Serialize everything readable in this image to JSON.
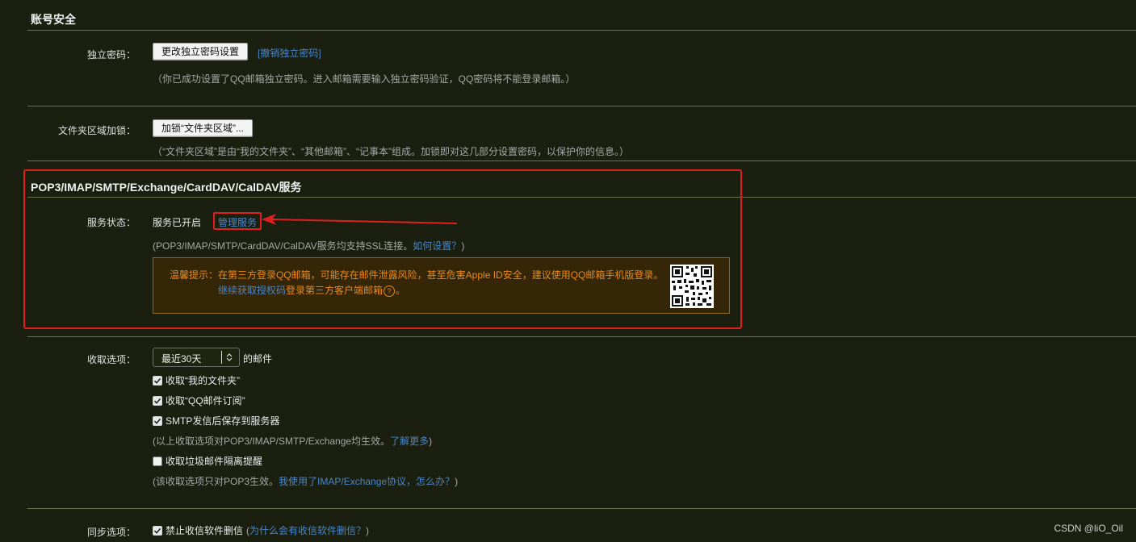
{
  "account_security": {
    "title": "账号安全",
    "independent_password": {
      "label": "独立密码：",
      "change_button": "更改独立密码设置",
      "revoke_link": "[撤销独立密码]",
      "note": "（你已成功设置了QQ邮箱独立密码。进入邮箱需要输入独立密码验证，QQ密码将不能登录邮箱。）"
    },
    "folder_lock": {
      "label": "文件夹区域加锁：",
      "button": "加锁“文件夹区域”...",
      "note": "（“文件夹区域”是由“我的文件夹”、“其他邮箱”、“记事本”组成。加锁即对这几部分设置密码，以保护你的信息。）"
    }
  },
  "services": {
    "title": "POP3/IMAP/SMTP/Exchange/CardDAV/CalDAV服务",
    "status": {
      "label": "服务状态：",
      "value": "服务已开启",
      "manage_link": "管理服务",
      "note_prefix": "(POP3/IMAP/SMTP/CardDAV/CalDAV服务均支持SSL连接。",
      "note_link": "如何设置？",
      "note_suffix": ")"
    },
    "warning": {
      "heading": "温馨提示：",
      "text": "在第三方登录QQ邮箱，可能存在邮件泄露风险，甚至危害Apple ID安全，建议使用QQ邮箱手机版登录。",
      "link": "继续获取授权码",
      "text2": "登录第三方客户端邮箱",
      "help_icon": "?",
      "end": "。"
    },
    "highlight_color": "#e02020"
  },
  "receive_options": {
    "label": "收取选项：",
    "range_select": "最近30天",
    "range_suffix": "的邮件",
    "checks": [
      {
        "label": "收取“我的文件夹”",
        "checked": true
      },
      {
        "label": "收取“QQ邮件订阅”",
        "checked": true
      },
      {
        "label": "SMTP发信后保存到服务器",
        "checked": true
      }
    ],
    "note1_prefix": "(以上收取选项对POP3/IMAP/SMTP/Exchange均生效。",
    "note1_link": "了解更多",
    "note1_suffix": ")",
    "spam_check": {
      "label": "收取垃圾邮件隔离提醒",
      "checked": false
    },
    "note2_prefix": "(该收取选项只对POP3生效。",
    "note2_link": "我使用了IMAP/Exchange协议，怎么办？",
    "note2_suffix": ")"
  },
  "sync_options": {
    "label": "同步选项：",
    "check_label": "禁止收信软件删信",
    "check_checked": true,
    "note_prefix": "(",
    "note_link": "为什么会有收信软件删信？",
    "note_suffix": ")"
  },
  "watermark": "CSDN @liO_Oil"
}
